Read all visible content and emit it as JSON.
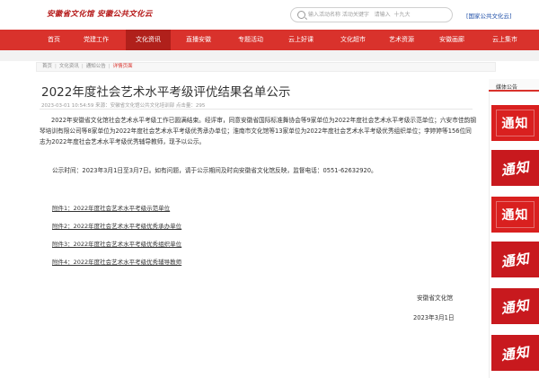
{
  "header": {
    "logo_text": "安徽省文化馆  安徽公共文化云",
    "search_placeholder": "输入活动名称 活动关键字   请输入  十九大",
    "top_link": "[国家公共文化云]"
  },
  "nav": {
    "items": [
      {
        "label": "首页"
      },
      {
        "label": "党建工作"
      },
      {
        "label": "文化资讯"
      },
      {
        "label": "直播安徽"
      },
      {
        "label": "专题活动"
      },
      {
        "label": "云上好课"
      },
      {
        "label": "文化超市"
      },
      {
        "label": "艺术资源"
      },
      {
        "label": "安徽画廊"
      },
      {
        "label": "云上集市"
      }
    ],
    "active_index": 2
  },
  "breadcrumb": {
    "items": [
      "首页",
      "文化资讯",
      "通知公告"
    ],
    "current": "详情页面"
  },
  "article": {
    "title": "2022年度社会艺术水平考级评优结果名单公示",
    "meta": "2023-03-01 10:54:59  来源：安徽省文化馆公共文化培训部  点击量：295",
    "body": "2022年安徽省文化馆社会艺术水平考级工作已圆满结束。经评审，同意安徽省国际标准舞协会等9家单位为2022年度社会艺术水平考级示范单位；六安市佳韵钢琴培训有限公司等8家单位为2022年度社会艺术水平考级优秀承办单位；淮南市文化馆等13家单位为2022年度社会艺术水平考级优秀组织单位；李婷婷等156位同志为2022年度社会艺术水平考级优秀辅导教师，现予以公示。",
    "notice": "公示时间：2023年3月1日至3月7日。如有问题，请于公示期间及时向安徽省文化馆反映，监督电话：0551-62632920。",
    "attachments": [
      "附件1：2022年度社会艺术水平考级示范单位",
      "附件2：2022年度社会艺术水平考级优秀承办单位",
      "附件3：2022年度社会艺术水平考级优秀组织单位",
      "附件4：2022年度社会艺术水平考级优秀辅导教师"
    ],
    "sign_org": "安徽省文化馆",
    "sign_date": "2023年3月1日"
  },
  "sidebar": {
    "title": "媒体公告",
    "tiles": [
      {
        "label": "通知"
      },
      {
        "label": "通知"
      },
      {
        "label": "通知"
      },
      {
        "label": "通知"
      },
      {
        "label": "通知"
      },
      {
        "label": "通知"
      }
    ]
  },
  "colors": {
    "brand_red": "#d9322c",
    "nav_active": "#b0201b",
    "link_blue": "#1f4fa8"
  }
}
